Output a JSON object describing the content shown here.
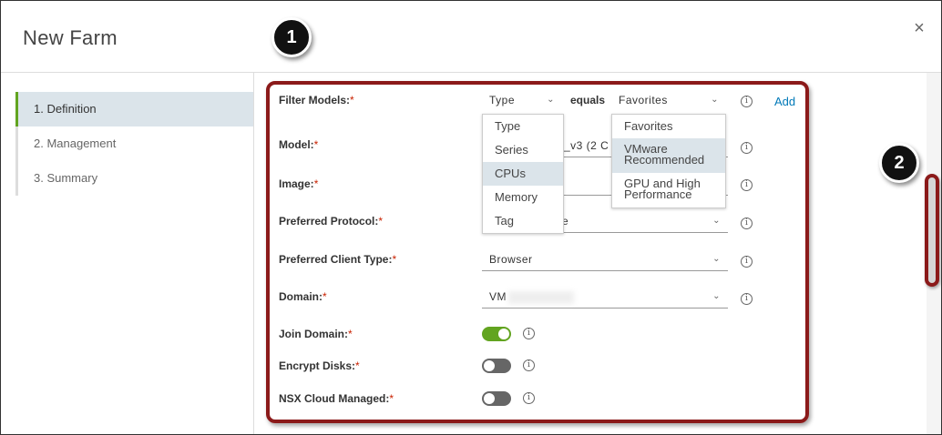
{
  "dialog": {
    "title": "New Farm",
    "close_icon": "×"
  },
  "steps": [
    {
      "label": "1. Definition",
      "active": true
    },
    {
      "label": "2. Management",
      "active": false
    },
    {
      "label": "3. Summary",
      "active": false
    }
  ],
  "form": {
    "filter_models": {
      "label": "Filter Models:",
      "type_select": "Type",
      "equals": "equals",
      "value_select": "Favorites",
      "add": "Add"
    },
    "model": {
      "label": "Model:",
      "value": "_v3 (2 C"
    },
    "image": {
      "label": "Image:",
      "value": ""
    },
    "preferred_protocol": {
      "label": "Preferred Protocol:",
      "value": "e"
    },
    "preferred_client_type": {
      "label": "Preferred Client Type:",
      "value": "Browser"
    },
    "domain": {
      "label": "Domain:",
      "value": "VM"
    },
    "join_domain": {
      "label": "Join Domain:",
      "on": true
    },
    "encrypt_disks": {
      "label": "Encrypt Disks:",
      "on": false
    },
    "nsx_cloud_managed": {
      "label": "NSX Cloud Managed:",
      "on": false
    },
    "required_mark": "*",
    "info_glyph": "i"
  },
  "type_dropdown": {
    "options": [
      "Type",
      "Series",
      "CPUs",
      "Memory",
      "Tag"
    ],
    "highlighted": "CPUs"
  },
  "value_dropdown": {
    "options": [
      {
        "line1": "Favorites",
        "line2": ""
      },
      {
        "line1": "VMware",
        "line2": "Recommended"
      },
      {
        "line1": "GPU and High",
        "line2": "Performance"
      }
    ],
    "highlighted": "VMware Recommended"
  },
  "callouts": [
    "1",
    "2"
  ],
  "colors": {
    "callout_border": "#8b1a1a",
    "accent_green": "#62a420",
    "link_blue": "#0079b8",
    "required_red": "#c92100"
  },
  "icons": {
    "chevron": "⌄"
  }
}
